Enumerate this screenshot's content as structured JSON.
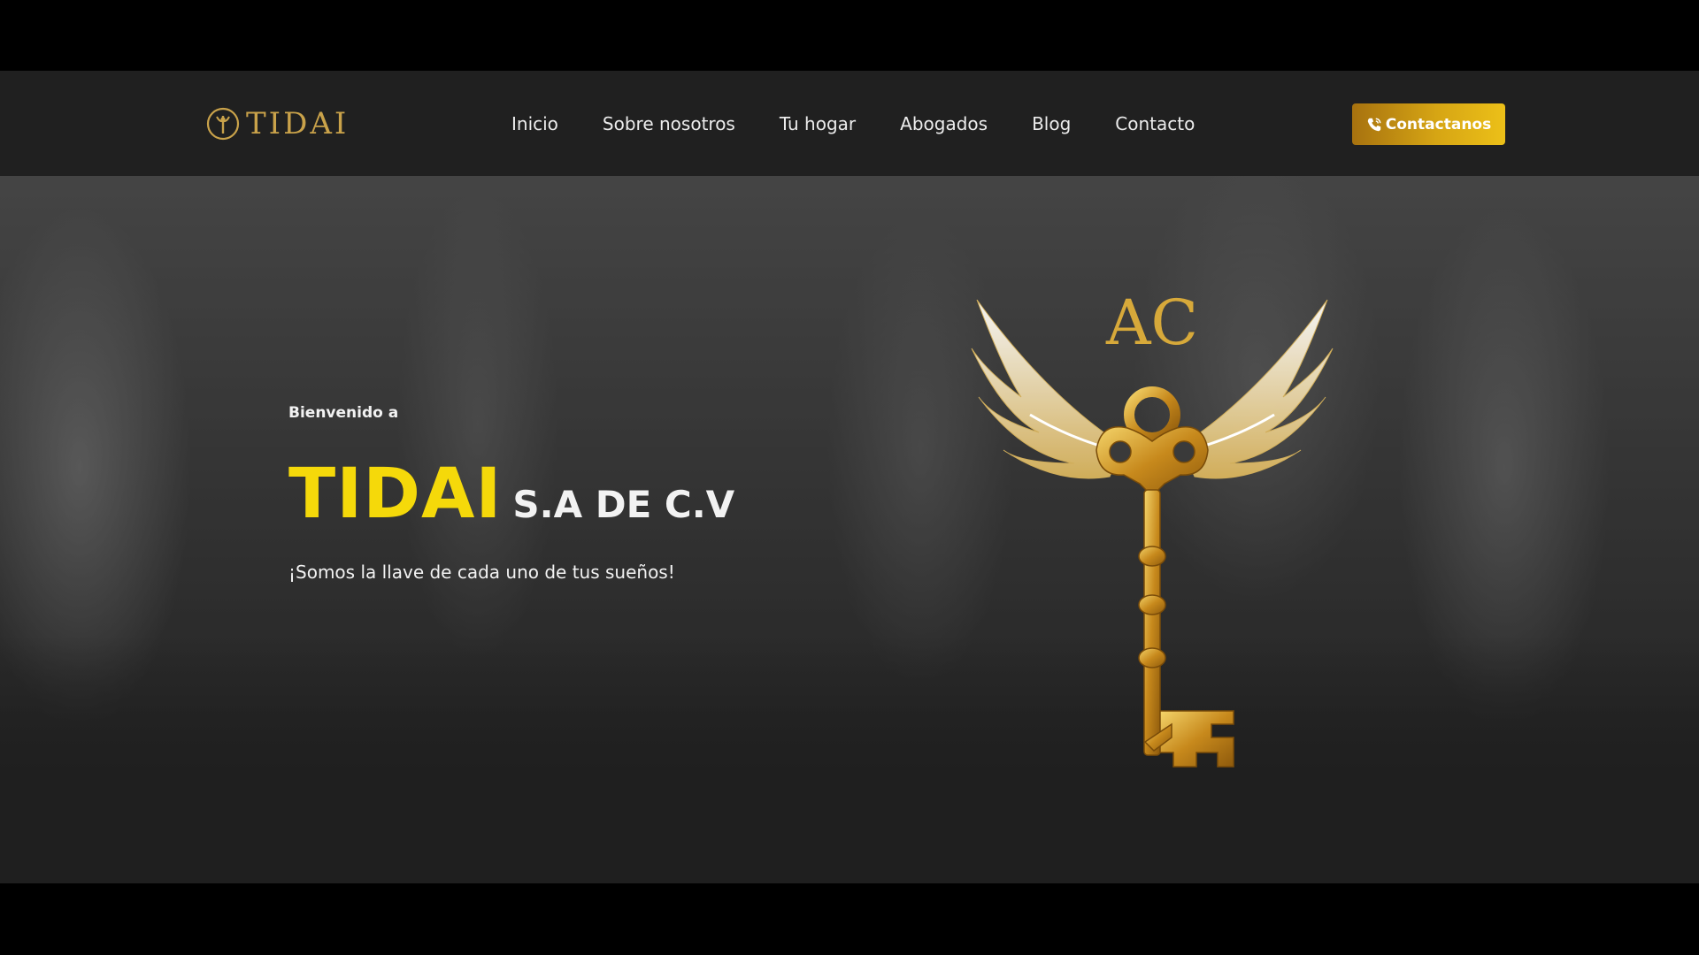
{
  "header": {
    "logo_text": "TIDAI",
    "logo_icon": "tidai-key-circle-icon",
    "nav": [
      {
        "label": "Inicio"
      },
      {
        "label": "Sobre nosotros"
      },
      {
        "label": "Tu hogar"
      },
      {
        "label": "Abogados"
      },
      {
        "label": "Blog"
      },
      {
        "label": "Contacto"
      }
    ],
    "cta": {
      "label": "Contactanos",
      "icon": "phone-icon"
    }
  },
  "hero": {
    "welcome": "Bienvenido a",
    "brand": "TIDAI",
    "brand_suffix": "S.A DE C.V",
    "tagline": "¡Somos la llave de cada uno de tus sueños!",
    "emblem_monogram": "AC",
    "emblem_icon": "winged-key-icon"
  },
  "colors": {
    "accent_yellow": "#f5d90a",
    "gold": "#c9a24a",
    "cta_gradient_start": "#a7720f",
    "cta_gradient_end": "#ecc018",
    "navbar_bg": "#202020",
    "page_bg": "#1f1f1f"
  }
}
